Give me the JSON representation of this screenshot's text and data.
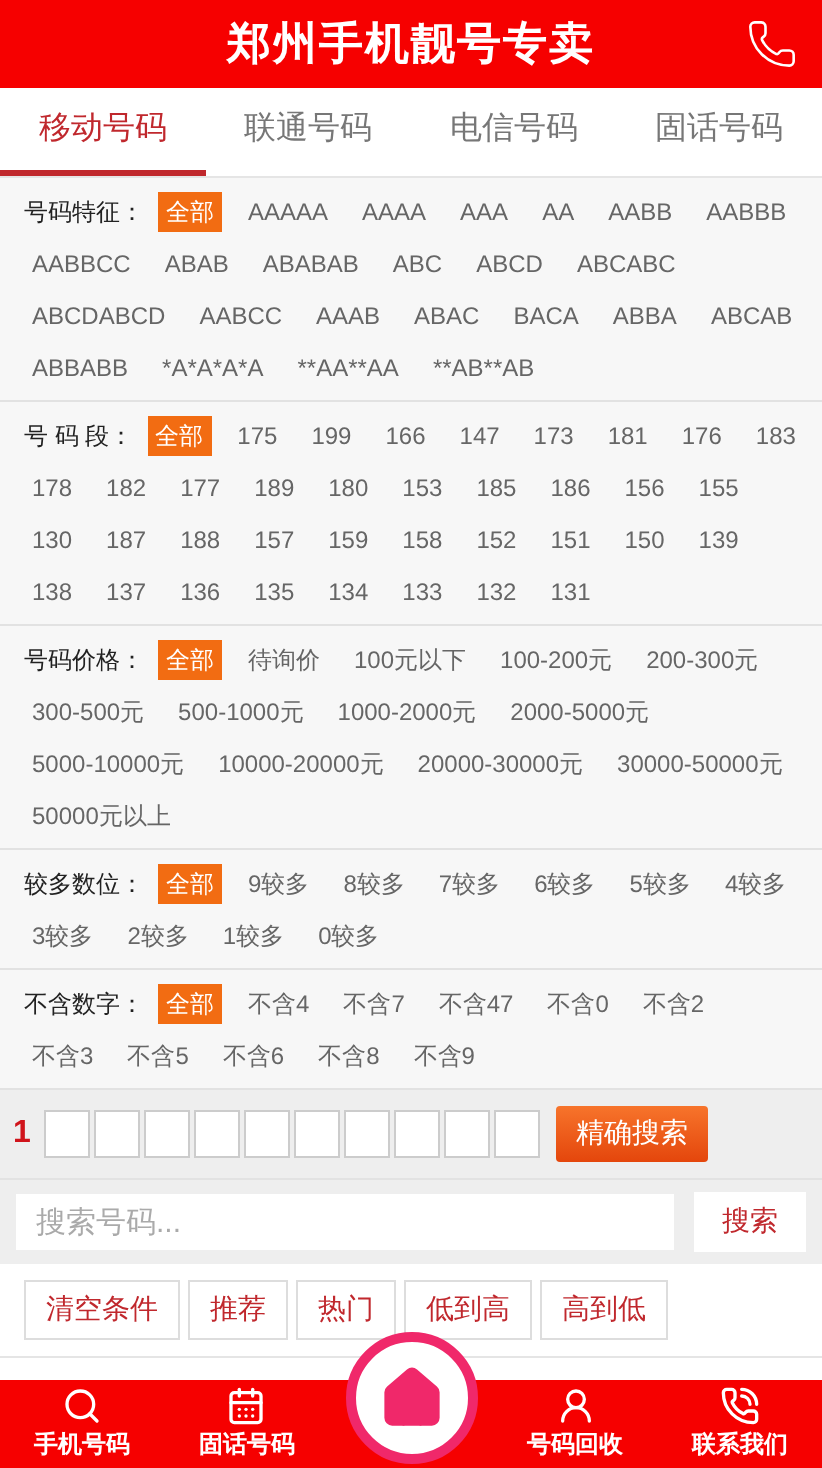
{
  "header": {
    "title": "郑州手机靓号专卖"
  },
  "tabs": [
    {
      "label": "移动号码",
      "selected": true
    },
    {
      "label": "联通号码",
      "selected": false
    },
    {
      "label": "电信号码",
      "selected": false
    },
    {
      "label": "固话号码",
      "selected": false
    }
  ],
  "filters": [
    {
      "label": "号码特征：",
      "options": [
        {
          "label": "全部",
          "selected": true
        },
        {
          "label": "AAAAA",
          "selected": false
        },
        {
          "label": "AAAA",
          "selected": false
        },
        {
          "label": "AAA",
          "selected": false
        },
        {
          "label": "AA",
          "selected": false
        },
        {
          "label": "AABB",
          "selected": false
        },
        {
          "label": "AABBB",
          "selected": false
        },
        {
          "label": "AABBCC",
          "selected": false
        },
        {
          "label": "ABAB",
          "selected": false
        },
        {
          "label": "ABABAB",
          "selected": false
        },
        {
          "label": "ABC",
          "selected": false
        },
        {
          "label": "ABCD",
          "selected": false
        },
        {
          "label": "ABCABC",
          "selected": false
        },
        {
          "label": "ABCDABCD",
          "selected": false
        },
        {
          "label": "AABCC",
          "selected": false
        },
        {
          "label": "AAAB",
          "selected": false
        },
        {
          "label": "ABAC",
          "selected": false
        },
        {
          "label": "BACA",
          "selected": false
        },
        {
          "label": "ABBA",
          "selected": false
        },
        {
          "label": "ABCAB",
          "selected": false
        },
        {
          "label": "ABBABB",
          "selected": false
        },
        {
          "label": "*A*A*A*A",
          "selected": false
        },
        {
          "label": "**AA**AA",
          "selected": false
        },
        {
          "label": "**AB**AB",
          "selected": false
        }
      ]
    },
    {
      "label": "号 码 段：",
      "options": [
        {
          "label": "全部",
          "selected": true
        },
        {
          "label": "175",
          "selected": false
        },
        {
          "label": "199",
          "selected": false
        },
        {
          "label": "166",
          "selected": false
        },
        {
          "label": "147",
          "selected": false
        },
        {
          "label": "173",
          "selected": false
        },
        {
          "label": "181",
          "selected": false
        },
        {
          "label": "176",
          "selected": false
        },
        {
          "label": "183",
          "selected": false
        },
        {
          "label": "178",
          "selected": false
        },
        {
          "label": "182",
          "selected": false
        },
        {
          "label": "177",
          "selected": false
        },
        {
          "label": "189",
          "selected": false
        },
        {
          "label": "180",
          "selected": false
        },
        {
          "label": "153",
          "selected": false
        },
        {
          "label": "185",
          "selected": false
        },
        {
          "label": "186",
          "selected": false
        },
        {
          "label": "156",
          "selected": false
        },
        {
          "label": "155",
          "selected": false
        },
        {
          "label": "130",
          "selected": false
        },
        {
          "label": "187",
          "selected": false
        },
        {
          "label": "188",
          "selected": false
        },
        {
          "label": "157",
          "selected": false
        },
        {
          "label": "159",
          "selected": false
        },
        {
          "label": "158",
          "selected": false
        },
        {
          "label": "152",
          "selected": false
        },
        {
          "label": "151",
          "selected": false
        },
        {
          "label": "150",
          "selected": false
        },
        {
          "label": "139",
          "selected": false
        },
        {
          "label": "138",
          "selected": false
        },
        {
          "label": "137",
          "selected": false
        },
        {
          "label": "136",
          "selected": false
        },
        {
          "label": "135",
          "selected": false
        },
        {
          "label": "134",
          "selected": false
        },
        {
          "label": "133",
          "selected": false
        },
        {
          "label": "132",
          "selected": false
        },
        {
          "label": "131",
          "selected": false
        }
      ]
    },
    {
      "label": "号码价格：",
      "options": [
        {
          "label": "全部",
          "selected": true
        },
        {
          "label": "待询价",
          "selected": false
        },
        {
          "label": "100元以下",
          "selected": false
        },
        {
          "label": "100-200元",
          "selected": false
        },
        {
          "label": "200-300元",
          "selected": false
        },
        {
          "label": "300-500元",
          "selected": false
        },
        {
          "label": "500-1000元",
          "selected": false
        },
        {
          "label": "1000-2000元",
          "selected": false
        },
        {
          "label": "2000-5000元",
          "selected": false
        },
        {
          "label": "5000-10000元",
          "selected": false
        },
        {
          "label": "10000-20000元",
          "selected": false
        },
        {
          "label": "20000-30000元",
          "selected": false
        },
        {
          "label": "30000-50000元",
          "selected": false
        },
        {
          "label": "50000元以上",
          "selected": false
        }
      ]
    },
    {
      "label": "较多数位：",
      "options": [
        {
          "label": "全部",
          "selected": true
        },
        {
          "label": "9较多",
          "selected": false
        },
        {
          "label": "8较多",
          "selected": false
        },
        {
          "label": "7较多",
          "selected": false
        },
        {
          "label": "6较多",
          "selected": false
        },
        {
          "label": "5较多",
          "selected": false
        },
        {
          "label": "4较多",
          "selected": false
        },
        {
          "label": "3较多",
          "selected": false
        },
        {
          "label": "2较多",
          "selected": false
        },
        {
          "label": "1较多",
          "selected": false
        },
        {
          "label": "0较多",
          "selected": false
        }
      ]
    },
    {
      "label": "不含数字：",
      "options": [
        {
          "label": "全部",
          "selected": true
        },
        {
          "label": "不含4",
          "selected": false
        },
        {
          "label": "不含7",
          "selected": false
        },
        {
          "label": "不含47",
          "selected": false
        },
        {
          "label": "不含0",
          "selected": false
        },
        {
          "label": "不含2",
          "selected": false
        },
        {
          "label": "不含3",
          "selected": false
        },
        {
          "label": "不含5",
          "selected": false
        },
        {
          "label": "不含6",
          "selected": false
        },
        {
          "label": "不含8",
          "selected": false
        },
        {
          "label": "不含9",
          "selected": false
        }
      ]
    }
  ],
  "exact_search": {
    "prefix": "1",
    "button": "精确搜索"
  },
  "search": {
    "placeholder": "搜索号码...",
    "button": "搜索"
  },
  "sort_buttons": [
    "清空条件",
    "推荐",
    "热门",
    "低到高",
    "高到低"
  ],
  "bottom_nav": [
    {
      "kind": "search",
      "label": "手机号码"
    },
    {
      "kind": "calendar",
      "label": "固话号码"
    },
    {
      "kind": "home"
    },
    {
      "kind": "user",
      "label": "号码回收"
    },
    {
      "kind": "phone",
      "label": "联系我们"
    }
  ]
}
